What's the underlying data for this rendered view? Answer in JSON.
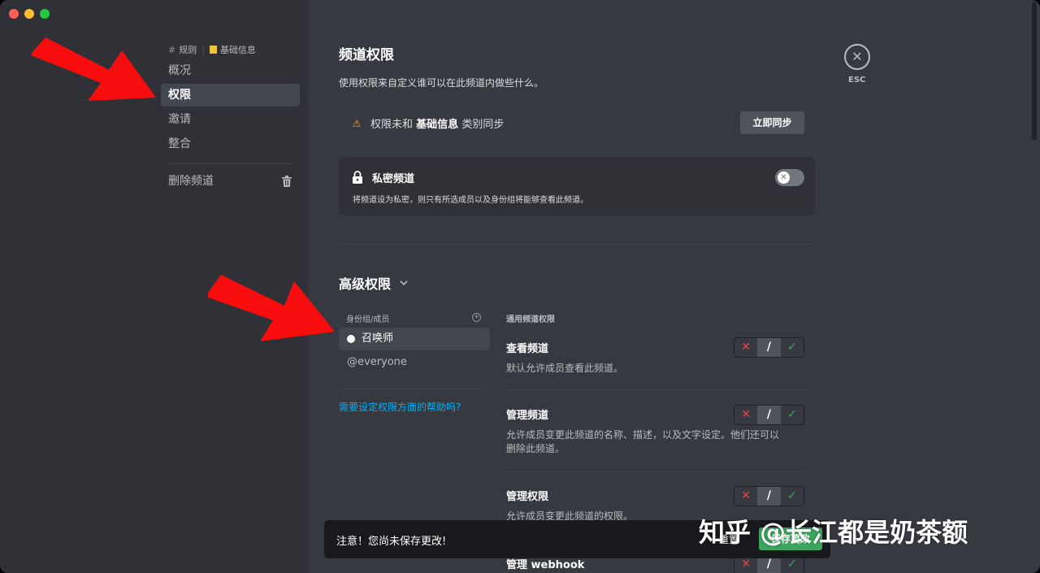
{
  "breadcrumb": {
    "hash": "#",
    "channel": "规则",
    "category": "基础信息"
  },
  "sidebar": {
    "items": [
      {
        "label": "概况"
      },
      {
        "label": "权限"
      },
      {
        "label": "邀请"
      },
      {
        "label": "整合"
      }
    ],
    "delete_label": "删除频道"
  },
  "header": {
    "title": "频道权限",
    "subtitle": "使用权限来自定义谁可以在此频道内做些什么。",
    "sync_prefix": "权限未和",
    "sync_category": "基础信息",
    "sync_suffix": "类别同步",
    "sync_button": "立即同步"
  },
  "private": {
    "title": "私密频道",
    "description": "将频道设为私密，则只有所选成员以及身份组将能够查看此频道。"
  },
  "advanced": {
    "title": "高级权限",
    "roles_header": "身份组/成员",
    "roles": [
      {
        "label": "召唤师"
      },
      {
        "label": "@everyone"
      }
    ],
    "help_link": "需要设定权限方面的帮助吗?",
    "perm_header": "通用频道权限",
    "permissions": [
      {
        "title": "查看频道",
        "description": "默认允许成员查看此频道。"
      },
      {
        "title": "管理频道",
        "description": "允许成员变更此频道的名称、描述，以及文字设定。他们还可以删除此频道。"
      },
      {
        "title": "管理权限",
        "description": "允许成员变更此频道的权限。"
      },
      {
        "title": "管理 webhook",
        "description": ""
      }
    ]
  },
  "tri": {
    "deny": "✕",
    "neutral": "/",
    "allow": "✓"
  },
  "esc": {
    "label": "ESC",
    "icon": "✕"
  },
  "notice": {
    "text": "注意！您尚未保存更改!",
    "reset": "重置",
    "save": "保存更改"
  },
  "watermark": "知乎 @长江都是奶茶额",
  "colors": {
    "accent": "#3ba55d",
    "deny": "#ed4245",
    "link": "#00aff4",
    "arrow": "#f70d0d"
  }
}
